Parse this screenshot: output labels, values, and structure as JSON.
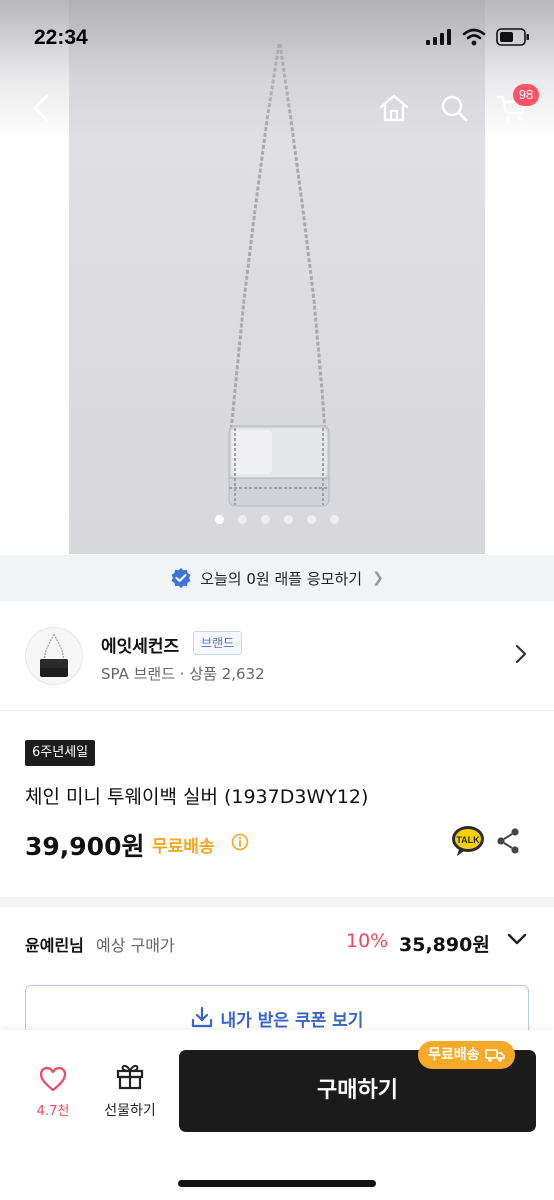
{
  "status_bar": {
    "time": "22:34"
  },
  "nav": {
    "cart_count": "98"
  },
  "gallery": {
    "image_count": 6,
    "active_index": 0
  },
  "raffle": {
    "text": "오늘의 0원 래플 응모하기"
  },
  "brand": {
    "name": "에잇세컨즈",
    "badge": "브랜드",
    "subtitle": "SPA 브랜드 · 상품 2,632"
  },
  "product": {
    "sale_tag": "6주년세일",
    "title": "체인 미니 투웨이백  실버 (1937D3WY12)",
    "price": "39,900원",
    "shipping": "무료배송"
  },
  "expected": {
    "name": "윤예린님",
    "label": "예상 구매가",
    "discount": "10%",
    "price": "35,890원"
  },
  "coupon": {
    "label": "내가 받은 쿠폰 보기"
  },
  "bottom_bar": {
    "like_count": "4.7천",
    "gift_label": "선물하기",
    "buy_label": "구매하기",
    "shipping_pill": "무료배송"
  },
  "colors": {
    "accent_red": "#f2475f",
    "shipping_orange": "#f5a623",
    "coupon_blue": "#3a64c9",
    "buy_button": "#1b1b1b"
  }
}
